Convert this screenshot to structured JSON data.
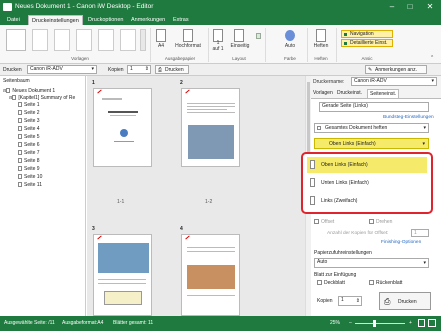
{
  "titlebar": {
    "title": "Neues Dokument 1 - Canon iW Desktop - Editor"
  },
  "menu": [
    "Datei",
    "Druckeinstellungen",
    "Druckoptionen",
    "Anmerkungen",
    "Extras"
  ],
  "ribbon": {
    "vorlagen": "Vorlagen",
    "ausgabe": {
      "a4": "A4",
      "hochformat": "Hochformat",
      "one": "1",
      "auf1": "auf 1",
      "einseitig": "Einseitig",
      "auto": "Auto",
      "heften": "Heften",
      "group": "Ausgabepapier",
      "layout": "Layout",
      "farbe": "Farbe",
      "heften_group": "Heften"
    },
    "navigation": "Navigation",
    "detail": "Detaillierte Einst.",
    "ansicht": "Ansic"
  },
  "toolbar": {
    "drucken_label": "Drucken",
    "drucker": "Canon iR-ADV",
    "kopien_label": "Kopien",
    "kopien": "1",
    "drucken_btn": "Drucken",
    "anm_btn": "Anmerkungen anz."
  },
  "left": {
    "header": "Seitenbaum",
    "items": [
      "Neues Dokument 1",
      "[Kapitel1] Summary of Re",
      "Seite 1",
      "Seite 2",
      "Seite 3",
      "Seite 4",
      "Seite 5",
      "Seite 6",
      "Seite 7",
      "Seite 8",
      "Seite 9",
      "Seite 10",
      "Seite 11"
    ]
  },
  "preview": {
    "pages": [
      {
        "num": "1",
        "label": "1-1"
      },
      {
        "num": "2",
        "label": "1-2"
      },
      {
        "num": "3",
        "label": ""
      },
      {
        "num": "4",
        "label": ""
      }
    ]
  },
  "right": {
    "druckername_label": "Druckername:",
    "druckername": "Canon iR-ADV",
    "tabs": [
      "Vorlagen",
      "Druckeinst.",
      "Seiteneinst."
    ],
    "top_select": "Gerade Seite (Links)",
    "link1": "Bundsteg-Einstellungen",
    "gesamt": "Gesamtes Dokument heften",
    "selected": "Oben Links (Einfach)",
    "options": [
      "Oben Links (Einfach)",
      "Unten Links (Einfach)",
      "Links (Zweifach)"
    ],
    "offset": "Offset",
    "drehen": "Drehen",
    "anzahl": "Anzahl der Kopien für Offset:",
    "anzahl_val": "1",
    "link2": "Finishing-Optionen",
    "papierzufuhr": "Papierzufuhreinstellungen",
    "papier_val": "Auto",
    "blatt": "Blatt zur Einfügung",
    "deckblatt": "Deckblatt",
    "rueckblatt": "Rückenblatt",
    "kopien_label": "Kopien",
    "kopien": "1",
    "drucken": "Drucken"
  },
  "status": {
    "seite": "Ausgewählte Seite: /11",
    "format": "Ausgabeformat:A4",
    "blaetter": "Blätter gesamt: 11",
    "zoom": "25%"
  },
  "colors": {
    "green": "#1e7a3e",
    "accent": "#f0e040",
    "highlight": "#e0242e"
  }
}
